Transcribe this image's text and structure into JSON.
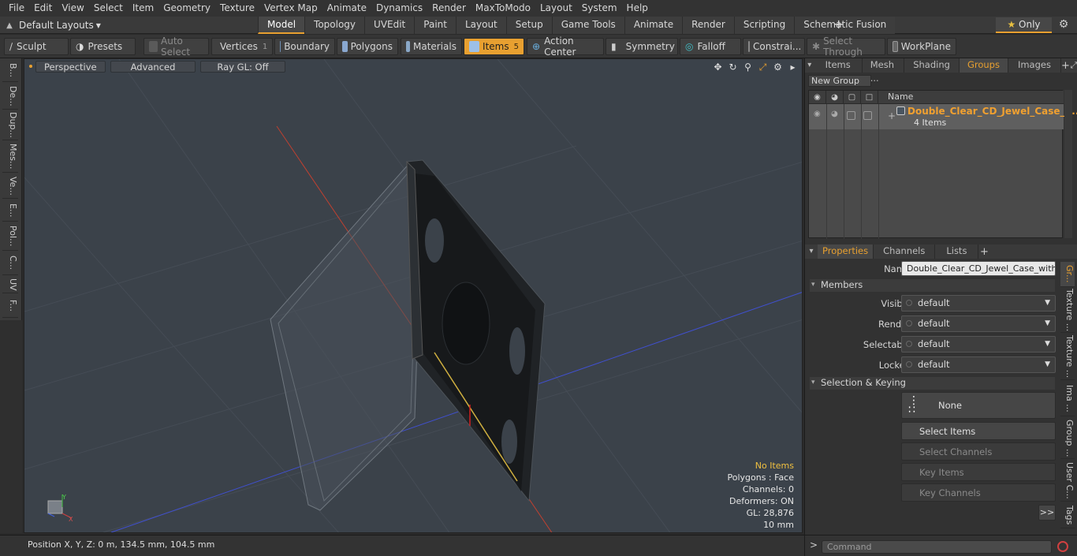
{
  "menubar": [
    "File",
    "Edit",
    "View",
    "Select",
    "Item",
    "Geometry",
    "Texture",
    "Vertex Map",
    "Animate",
    "Dynamics",
    "Render",
    "MaxToModo",
    "Layout",
    "System",
    "Help"
  ],
  "layouts": {
    "label": "Default Layouts"
  },
  "tabs": [
    "Model",
    "Topology",
    "UVEdit",
    "Paint",
    "Layout",
    "Setup",
    "Game Tools",
    "Animate",
    "Render",
    "Scripting",
    "Schematic Fusion"
  ],
  "only": {
    "label": "Only"
  },
  "toolbar": {
    "sculpt": "Sculpt",
    "presets": "Presets",
    "auto_select": "Auto Select",
    "vertices": "Vertices",
    "vertices_count": "1",
    "boundary": "Boundary",
    "polygons": "Polygons",
    "materials": "Materials",
    "items": "Items",
    "items_count": "5",
    "action_center": "Action Center",
    "symmetry": "Symmetry",
    "falloff": "Falloff",
    "constraints": "Constrai...",
    "select_through": "Select Through",
    "workplane": "WorkPlane"
  },
  "left_tabs": [
    "B...",
    "De...",
    "Dup...",
    "Mes...",
    "Ve...",
    "E...",
    "Pol...",
    "C...",
    "UV",
    "F..."
  ],
  "viewport": {
    "perspective": "Perspective",
    "advanced": "Advanced",
    "raygl": "Ray GL: Off",
    "stats": {
      "items": "No Items",
      "polygons": "Polygons : Face",
      "channels": "Channels: 0",
      "deformers": "Deformers: ON",
      "gl": "GL: 28,876",
      "scale": "10 mm"
    }
  },
  "status": {
    "position": "Position X, Y, Z:   0 m, 134.5 mm, 104.5 mm"
  },
  "panel_tabs": [
    "Items",
    "Mesh ...",
    "Shading",
    "Groups",
    "Images"
  ],
  "groups": {
    "new_group": "New Group",
    "name_header": "Name",
    "row": {
      "name": "Double_Clear_CD_Jewel_Case_ ...",
      "sub": "4 Items"
    }
  },
  "props_tabs": [
    "Properties",
    "Channels",
    "Lists"
  ],
  "properties": {
    "name_label": "Name",
    "name_value": "Double_Clear_CD_Jewel_Case_with_B",
    "members": "Members",
    "visible_label": "Visible",
    "visible_value": "default",
    "render_label": "Render",
    "render_value": "default",
    "selectable_label": "Selectable",
    "selectable_value": "default",
    "locked_label": "Locked",
    "locked_value": "default",
    "selection_keying": "Selection & Keying",
    "none": "None",
    "select_items": "Select Items",
    "select_channels": "Select Channels",
    "key_items": "Key Items",
    "key_channels": "Key Channels",
    "more": ">>"
  },
  "side_tabs": [
    "Gr...",
    "Texture ...",
    "Texture ...",
    "Ima ...",
    "Group ...",
    "User C...",
    "Tags"
  ],
  "command": {
    "placeholder": "Command"
  },
  "colors": {
    "accent": "#e8a030",
    "viewport_bg": "#3b424a"
  }
}
